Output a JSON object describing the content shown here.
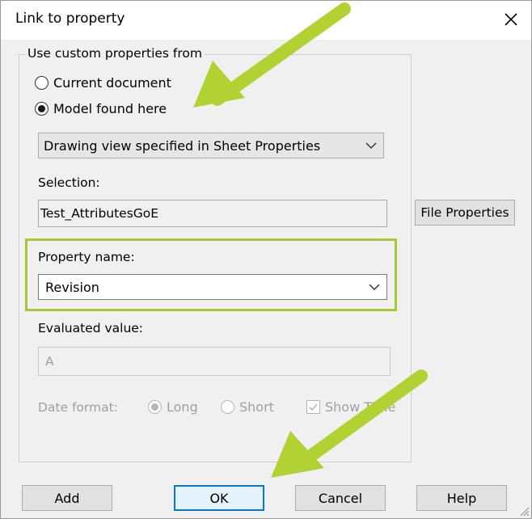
{
  "dialog": {
    "title": "Link to property",
    "close_icon": "close-icon"
  },
  "group": {
    "legend": "Use custom properties from"
  },
  "source": {
    "options": [
      {
        "label": "Current document",
        "checked": false
      },
      {
        "label": "Model found here",
        "checked": true
      }
    ],
    "dropdown_value": "Drawing view specified in Sheet Properties"
  },
  "selection": {
    "label": "Selection:",
    "value": "Test_AttributesGoE"
  },
  "file_properties_label": "File Properties",
  "property": {
    "label": "Property name:",
    "value": "Revision"
  },
  "evaluated": {
    "label": "Evaluated value:",
    "value": "A"
  },
  "date": {
    "label": "Date format:",
    "long_label": "Long",
    "short_label": "Short",
    "show_time_label": "Show Time"
  },
  "buttons": {
    "add": "Add",
    "ok": "OK",
    "cancel": "Cancel",
    "help": "Help"
  },
  "colors": {
    "highlight": "#a6c932",
    "arrow": "#b4d133"
  }
}
